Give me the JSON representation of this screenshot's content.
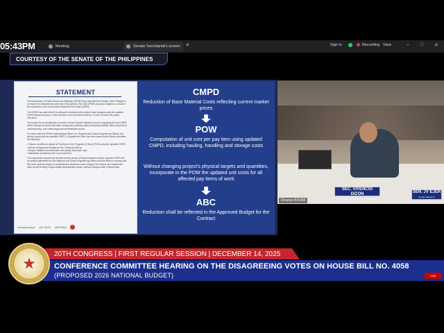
{
  "clock": "05:43PM",
  "tabs": [
    {
      "label": "Meeting"
    },
    {
      "label": "Senate Secretariat's screen"
    }
  ],
  "toolbar": {
    "signin": "Sign in",
    "recording": "Recording",
    "view": "View"
  },
  "courtesy": "COURTESY OF THE SENATE OF THE PHILIPPINES",
  "statement": {
    "title": "STATEMENT",
    "paragraphs": [
      "The Department of Public Works and Highways (DPWH) has requested the Senate of the Philippines to restore the deducted amounts from the projects in the 2026 DPWH proposed budget as a result of the reductions in the Construction Materials Price Data (CMPD).",
      "The DPWH has asked that it be allowed to implement the project costs changes using the updated CMPD Special Issuance, in the exercise of its executive functions, in order to ensure its proper execution.",
      "The motion for reconsideration is made to ensure that the detailed process of applying the new CMPD will be followed to avoid inaccurate costing and potential project unimplementability, which may lead to underspending, and related legal and administrative issues.",
      "To ensure that the DPWH Implementing Offices (i.e. Regional and District Engineering Offices) will strictly comply with the updated CMPD, a Department Order has been issued which strictly mandates the following:"
    ],
    "bullets": [
      "Follow a workflow to adjust all Pay Items in the Programs of Work (POW) using the updated CMPD;",
      "Revise all Approved Budgets for the Contracts (ABCs);",
      "Require detailed documentation and quality assurance; and,",
      "Mandatory compliance prior to procurement"
    ],
    "closing": "The Department assures the Senate and the House of Representatives that the updated CMPD will be strictly implemented at the Regional and District Engineering Offices and that failure to comply with this Order shall be subject to administrative sanctions under existing Civil Service and Department rules as well as filing of appropriate administrative and/or criminal charges under relevant laws.",
    "footer_site": "www.dpwh.gov.ph",
    "footer_phone": "(02) 165-02",
    "footer_social": "@DPWHph"
  },
  "panel": {
    "h1": "CMPD",
    "t1": "Reduction of Base Material Costs reflecting current market prices",
    "h2": "POW",
    "t2": "Computation of unit cost per pay item using updated CMPD, including hauling, handling and storage costs",
    "t3": "Without changing project's physical targets and quantities, incorporate in the POW the updated unit costs for all affected pay items of work",
    "h3": "ABC",
    "t4": "Reduction shall be reflected in the Approved Budget for the Contract"
  },
  "video": {
    "nameplate1": "SEC. VIVENCIO DIZON",
    "nameplate1_sub": "Department of Public Works and Highways",
    "nameplate2": "SEN. JV EJER",
    "nameplate2_sub": "Senate Deputy M",
    "label": "Finance BICAM"
  },
  "lower_third": {
    "session": "20TH CONGRESS | FIRST REGULAR SESSION | DECEMBER 14, 2025",
    "title": "CONFERENCE COMMITTEE HEARING ON THE DISAGREEING VOTES ON HOUSE BILL NO. 4058",
    "subtitle": "(PROPOSED 2026 NATIONAL BUDGET)",
    "badge": "LIVE"
  }
}
